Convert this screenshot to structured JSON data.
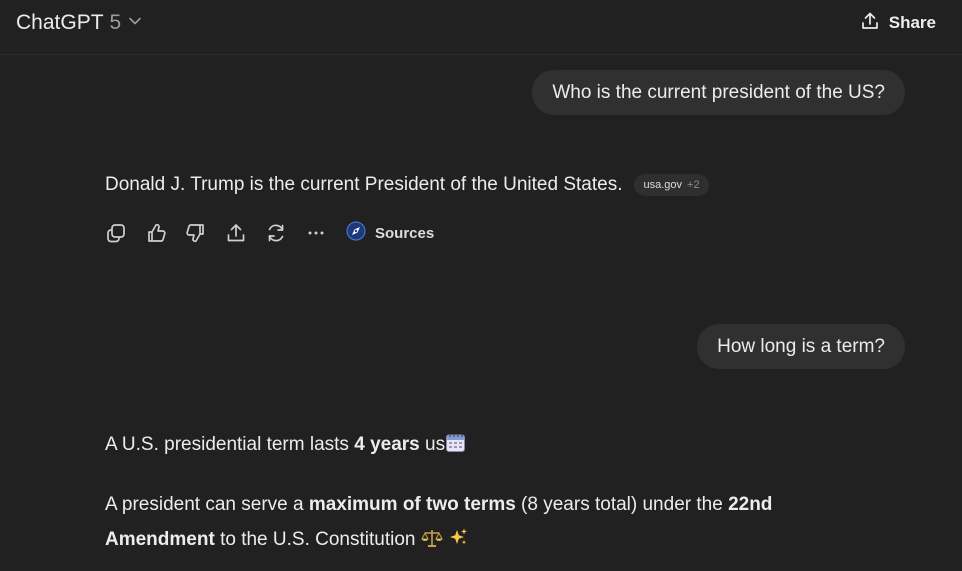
{
  "header": {
    "model_name": "ChatGPT",
    "model_version": "5",
    "share_label": "Share"
  },
  "messages": {
    "user_1": "Who is the current president of the US?",
    "assistant_1": {
      "text": "Donald J. Trump is the current President of the United States.",
      "source_chip": {
        "domain": "usa.gov",
        "more": "+2"
      }
    },
    "actions": {
      "sources_label": "Sources"
    },
    "user_2": "How long is a term?",
    "assistant_2": {
      "line_1": {
        "before": "A U.S. presidential term lasts ",
        "bold": "4 years",
        "after": " us"
      },
      "line_2": {
        "part_1": "A president can serve a ",
        "bold_1": "maximum of two terms",
        "part_2": " (8 years total) under the ",
        "bold_2": "22nd Amendment",
        "part_3": " to the U.S. Constitution "
      }
    }
  },
  "colors": {
    "background": "#212121",
    "bubble": "#303030",
    "text": "#ececec",
    "muted": "#9b9b9b",
    "sources_icon": "#3b6fd6"
  },
  "icons": [
    "chevron-down-icon",
    "share-icon",
    "copy-icon",
    "thumbs-up-icon",
    "thumbs-down-icon",
    "upload-icon",
    "regenerate-icon",
    "more-icon",
    "sources-icon",
    "calendar-emoji",
    "scales-emoji",
    "sparkles-emoji"
  ]
}
